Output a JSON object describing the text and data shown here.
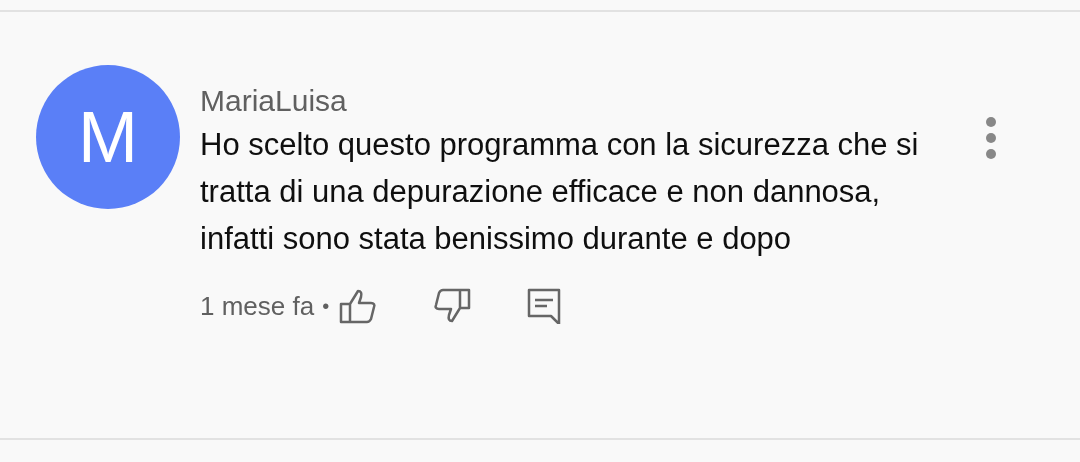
{
  "comment": {
    "author": "MariaLuisa",
    "avatar_letter": "M",
    "text": "Ho scelto questo programma con la sicurezza che si tratta di una depurazione efficace e non dannosa, infatti sono stata benissimo durante e dopo",
    "time": "1 mese fa",
    "separator": "•"
  }
}
